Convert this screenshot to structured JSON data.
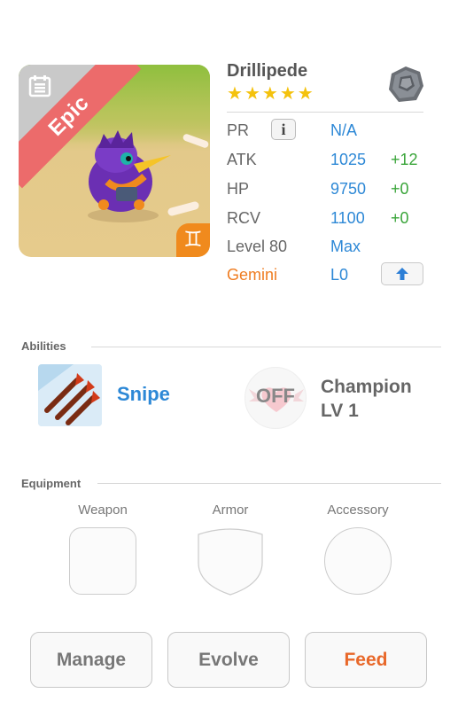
{
  "monster": {
    "name": "Drillipede",
    "rarity": "Epic",
    "star_count": 5,
    "zodiac_symbol": "♊",
    "element_icon": "stone-element-icon",
    "type_icon": "card-type-icon"
  },
  "stats": {
    "pr": {
      "label": "PR",
      "value": "N/A"
    },
    "atk": {
      "label": "ATK",
      "value": "1025",
      "bonus": "+12"
    },
    "hp": {
      "label": "HP",
      "value": "9750",
      "bonus": "+0"
    },
    "rcv": {
      "label": "RCV",
      "value": "1100",
      "bonus": "+0"
    },
    "level": {
      "label": "Level 80",
      "value": "Max"
    },
    "zodiac": {
      "label": "Gemini",
      "value": "L0"
    }
  },
  "abilities": {
    "title": "Abilities",
    "active": {
      "name": "Snipe",
      "icon": "snipe-arrows-icon"
    },
    "leader": {
      "status": "OFF",
      "name_line1": "Champion",
      "name_line2": "LV 1",
      "icon": "heart-wings-icon"
    }
  },
  "equipment": {
    "title": "Equipment",
    "weapon_label": "Weapon",
    "armor_label": "Armor",
    "accessory_label": "Accessory"
  },
  "actions": {
    "manage": "Manage",
    "evolve": "Evolve",
    "feed": "Feed"
  },
  "colors": {
    "stat_value": "#2d88d6",
    "stat_bonus": "#3aa53a",
    "zodiac": "#ef7d22",
    "rarity_ribbon": "#ec6b6b",
    "star": "#f4c20d"
  }
}
